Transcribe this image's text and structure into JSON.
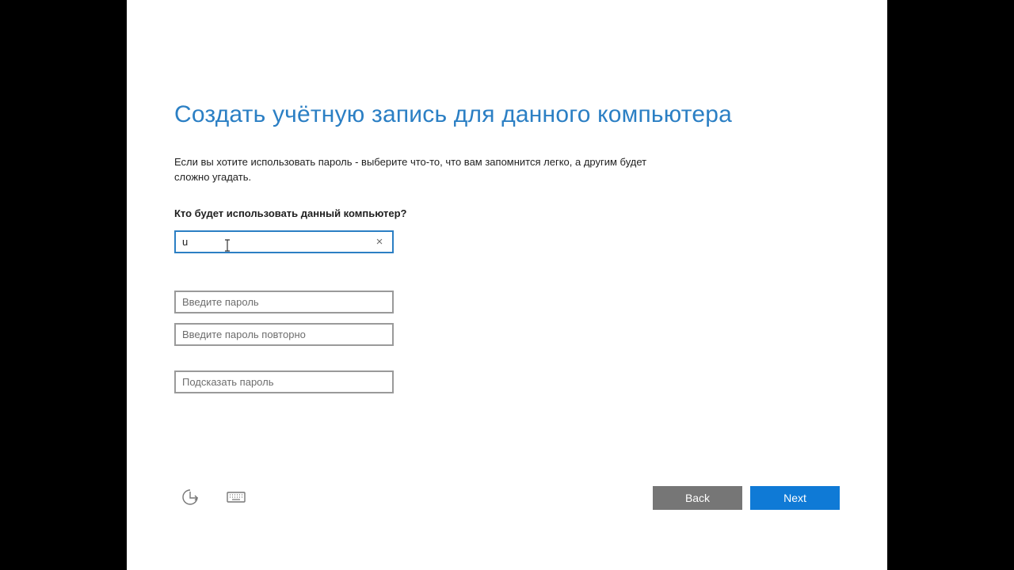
{
  "page": {
    "title": "Создать учётную запись для данного компьютера",
    "description": "Если вы хотите использовать пароль - выберите что-то, что вам запомнится легко, а другим будет сложно угадать.",
    "question": "Кто будет использовать данный компьютер?"
  },
  "fields": {
    "username": {
      "value": "u",
      "placeholder": ""
    },
    "password": {
      "value": "",
      "placeholder": "Введите пароль"
    },
    "password_confirm": {
      "value": "",
      "placeholder": "Введите пароль повторно"
    },
    "hint": {
      "value": "",
      "placeholder": "Подсказать пароль"
    }
  },
  "icons": {
    "clear": "×",
    "ease_of_access": "ease-of-access-icon",
    "keyboard": "keyboard-icon"
  },
  "buttons": {
    "back_label": "Back",
    "next_label": "Next"
  },
  "colors": {
    "accent": "#2b7fc4",
    "next_button": "#0f7ad6",
    "back_button": "#767676"
  }
}
